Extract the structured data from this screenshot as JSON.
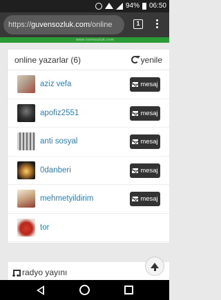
{
  "status_bar": {
    "battery": "94%",
    "time": "06:50"
  },
  "browser": {
    "url_scheme": "https://",
    "url_host": "guvensozluk.com",
    "url_path": "/online",
    "tab_count": "1"
  },
  "banner": {
    "text": "www.ozelsozluk.com"
  },
  "online_panel": {
    "title": "online yazarlar (6)",
    "refresh_label": "yenile",
    "message_label": "mesaj",
    "users": [
      {
        "name": "aziz vefa",
        "has_message": true
      },
      {
        "name": "apofiz2551",
        "has_message": true
      },
      {
        "name": "anti sosyal",
        "has_message": true
      },
      {
        "name": "0danberi",
        "has_message": true
      },
      {
        "name": "mehmetyildirim",
        "has_message": true
      },
      {
        "name": "tor",
        "has_message": false
      }
    ]
  },
  "radio_panel": {
    "title": "radyo yayını"
  },
  "colors": {
    "accent_green": "#2b9b36",
    "link_blue": "#2a7fb4",
    "button_dark": "#333333"
  }
}
